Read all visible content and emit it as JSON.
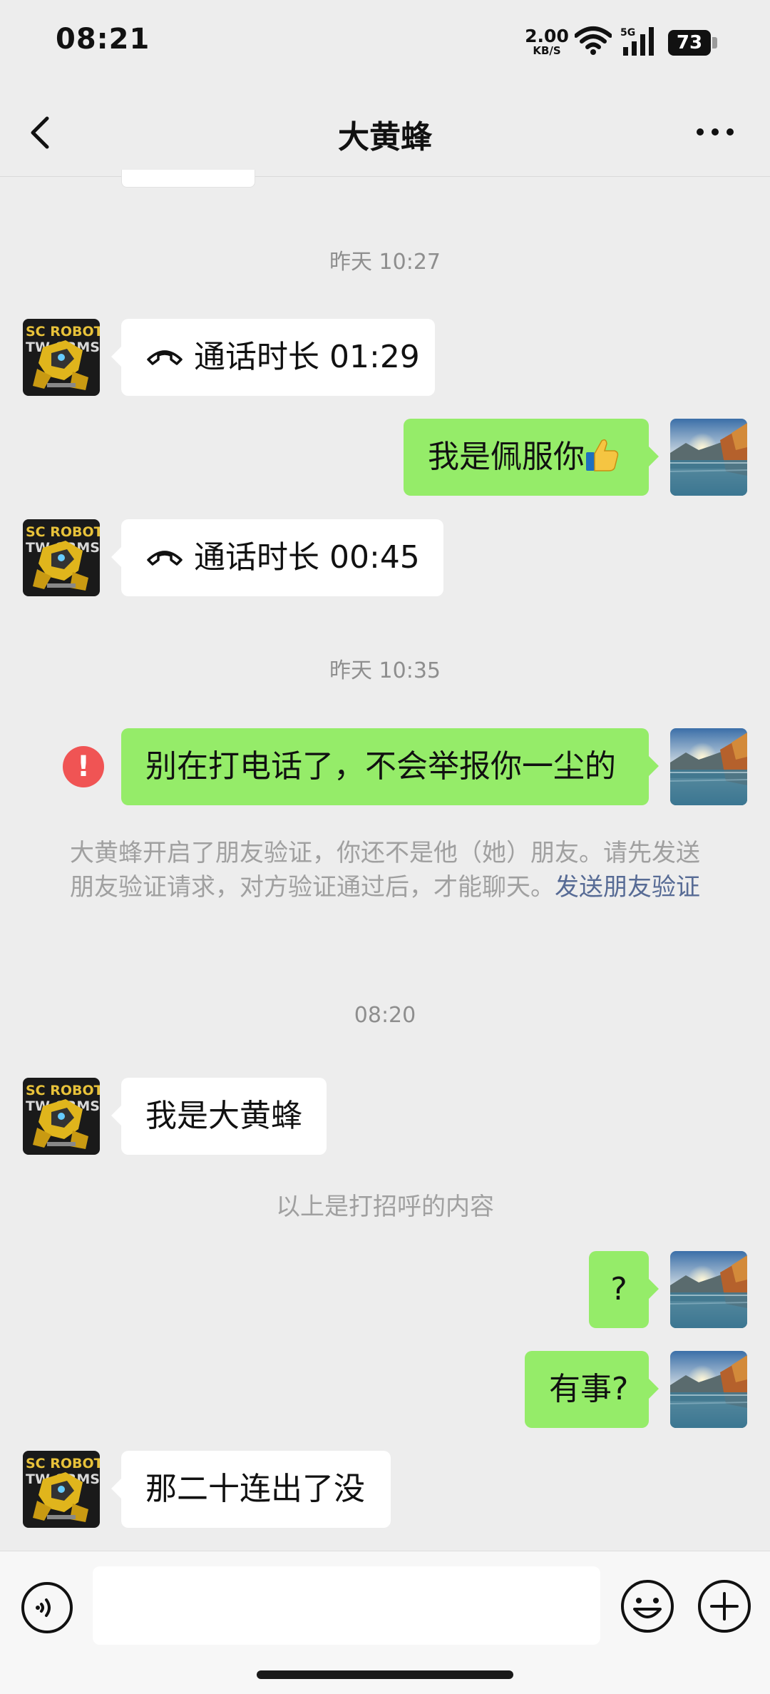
{
  "status_bar": {
    "time": "08:21",
    "net_speed_value": "2.00",
    "net_speed_unit": "KB/S",
    "network": "5G",
    "battery": "73"
  },
  "nav": {
    "title": "大黄蜂",
    "back_icon": "chevron-left-icon",
    "more_icon": "more-dots-icon"
  },
  "messages": {
    "ts1": "昨天 10:27",
    "call1": {
      "label": "通话时长",
      "duration": "01:29"
    },
    "msg_out1": "我是佩服你",
    "call2": {
      "label": "通话时长",
      "duration": "00:45"
    },
    "ts2": "昨天 10:35",
    "msg_out_failed": "别在打电话了，不会举报你一尘的",
    "system_notice": "大黄蜂开启了朋友验证，你还不是他（她）朋友。请先发送朋友验证请求，对方验证通过后，才能聊天。",
    "system_link": "发送朋友验证",
    "ts3": "08:20",
    "msg_in1": "我是大黄蜂",
    "greeting_separator": "以上是打招呼的内容",
    "msg_out2": "?",
    "msg_out3": "有事?",
    "msg_in2": "那二十连出了没"
  },
  "input_bar": {
    "placeholder": "",
    "voice_icon": "voice-icon",
    "emoji_icon": "emoji-icon",
    "plus_icon": "plus-icon"
  },
  "colors": {
    "background": "#ededed",
    "outgoing_bubble": "#95ec69",
    "incoming_bubble": "#ffffff",
    "link": "#576b95",
    "error": "#f05454"
  }
}
